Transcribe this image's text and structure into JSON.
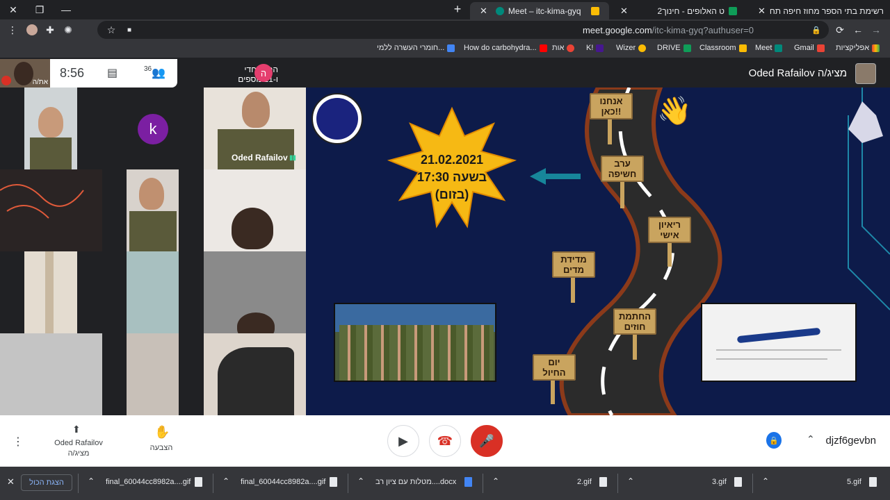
{
  "browser": {
    "tabs": [
      {
        "label": "רשימת בתי הספר מחוז חיפה תח",
        "favicon_color": "#0f9d58",
        "active": false
      },
      {
        "label": "2ט האלופים - חינוך",
        "favicon_color": "#0f9d58",
        "active": false
      },
      {
        "label": "Meet – itc-kima-gyq",
        "favicon_color": "#00897b",
        "active": true
      }
    ],
    "new_tab": "+",
    "url_host": "meet.google.com",
    "url_path": "/itc-kima-gyq?authuser=0",
    "bookmarks": [
      "אפליקציות",
      "Gmail",
      "Meet",
      "Classroom",
      "DRIVE",
      "Wizer",
      "K!",
      "אות",
      "How do carbohydra...",
      "חומרי העשרה ללמי..."
    ]
  },
  "meet": {
    "self_label": "את/ה",
    "time": "8:56",
    "participants_count": "36",
    "speaker_name": "הראל חדי",
    "speaker_more": "ו-21 נוספים",
    "speaker_initial": "ה",
    "presenter_title": "Oded Rafailov מציג/ה",
    "tile_name": "Oded Rafailov",
    "k_initial": "k",
    "slide": {
      "date": "21.02.2021",
      "time_line": "בשעה 17:30",
      "zoom_line": "(בזום)",
      "signs": [
        "אנחנו כאן!!",
        "ערב חשיפה",
        "ריאיון אישי",
        "מדידת מדים",
        "החתמת חוזים",
        "יום החיול"
      ]
    },
    "controls": {
      "present_name": "Oded Rafailov",
      "present_role": "מציג/ה",
      "raise_hand": "הצבעה",
      "meeting_code": "djzf6gevbn"
    }
  },
  "downloads": {
    "show_all": "הצגת הכול",
    "files": [
      "final_60044cc8982a....gif",
      "final_60044cc8982a....gif",
      "מטלות עם ציון רב....docx",
      "2.gif",
      "3.gif",
      "5.gif"
    ]
  }
}
